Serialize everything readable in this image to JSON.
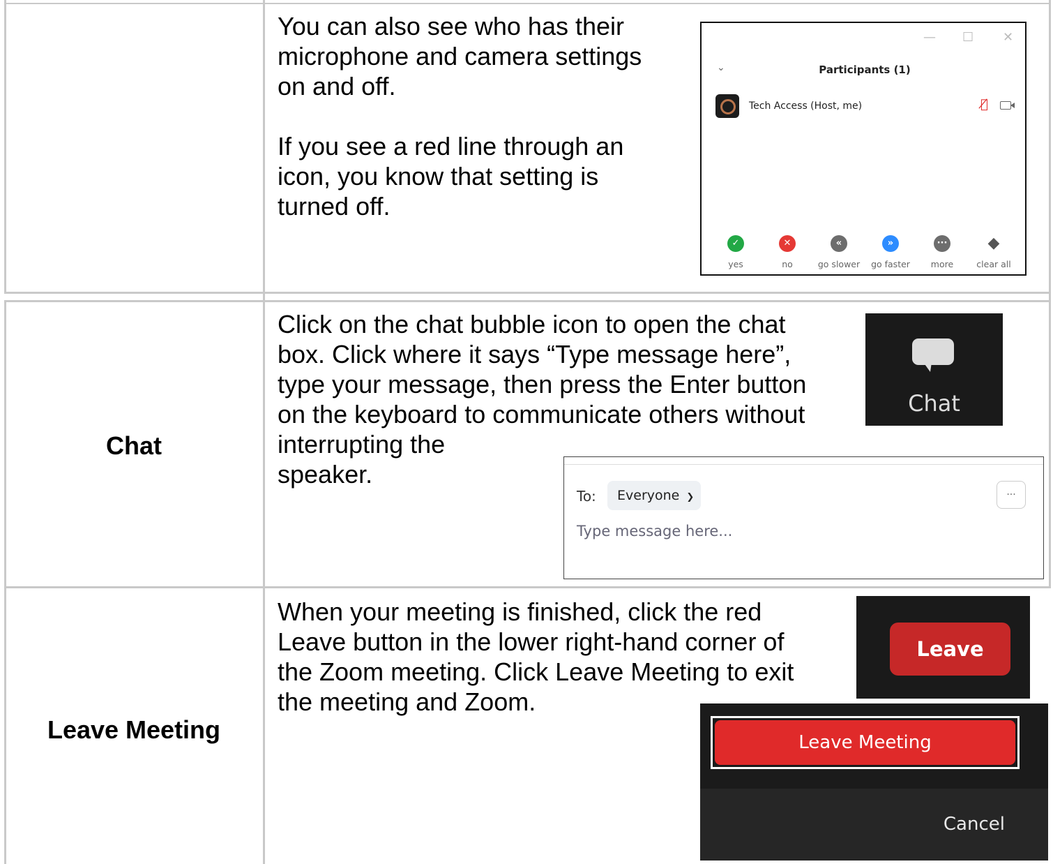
{
  "rows": {
    "participants": {
      "head": "",
      "text_p1": "You can also see who has their\nmicrophone and camera settings\non and off.",
      "text_p2": "If you see a red line through an\nicon, you know that setting is\nturned off."
    },
    "chat": {
      "head": "Chat",
      "text": "Click on the chat bubble icon to open the chat\nbox. Click where it says “Type message here”,\ntype your message, then press the Enter button\non the keyboard to communicate others without\ninterrupting the\nspeaker."
    },
    "leave": {
      "head": "Leave Meeting",
      "text": "When your meeting is finished, click the red\nLeave button in the lower right-hand corner of\nthe Zoom meeting. Click Leave Meeting to exit\nthe meeting and Zoom."
    }
  },
  "participants_window": {
    "title": "Participants (1)",
    "window_controls": [
      "—",
      "☐",
      "✕"
    ],
    "participant_name": "Tech Access (Host, me)",
    "reactions": [
      {
        "label": "yes",
        "color": "#22a845",
        "glyph": "✓"
      },
      {
        "label": "no",
        "color": "#e53935",
        "glyph": "✕"
      },
      {
        "label": "go slower",
        "color": "#6d6d6d",
        "glyph": "«"
      },
      {
        "label": "go faster",
        "color": "#2d8cff",
        "glyph": "»"
      },
      {
        "label": "more",
        "color": "#6d6d6d",
        "glyph": "···"
      },
      {
        "label": "clear all",
        "color": "#555555",
        "glyph": "◆"
      }
    ]
  },
  "chat_button": {
    "label": "Chat"
  },
  "chat_box": {
    "to_label": "To:",
    "recipient": "Everyone",
    "more": "···",
    "placeholder": "Type message here..."
  },
  "leave_button": {
    "label": "Leave"
  },
  "leave_dialog": {
    "leave_meeting": "Leave Meeting",
    "cancel": "Cancel"
  }
}
